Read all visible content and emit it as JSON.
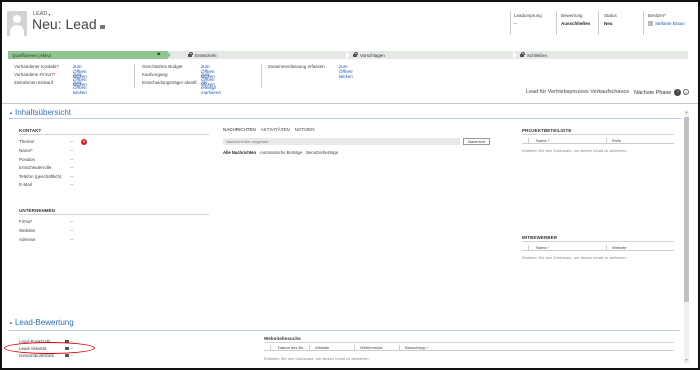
{
  "header": {
    "entity_type": "LEAD",
    "title": "Neu: Lead",
    "fields": [
      {
        "label": "Leadursprung",
        "value": "--"
      },
      {
        "label": "Bewertung",
        "value": "Ausschließen"
      },
      {
        "label": "Status",
        "value": "Neu"
      },
      {
        "label": "Besitzer",
        "value": "Stefanie Braun"
      }
    ]
  },
  "process": {
    "stages": [
      {
        "label": "Qualifizieren (Aktiv)",
        "active": true
      },
      {
        "label": "Entwickeln",
        "locked": true
      },
      {
        "label": "Vorschlagen",
        "locked": true
      },
      {
        "label": "Schließen",
        "locked": true
      }
    ],
    "fields": [
      {
        "label": "Vorhandener Kontakt?",
        "value": "zum Öffnen klicken"
      },
      {
        "label": "Vorhandene Firma?",
        "value": "zum Öffnen klicken"
      },
      {
        "label": "Zeitrahmen Einkauf",
        "value": "zum Öffnen klicken"
      },
      {
        "label": "Geschätztes Budget",
        "value": "zum Öffnen klicken"
      },
      {
        "label": "Kaufvorgang",
        "value": "zum Öffnen klicken"
      },
      {
        "label": "Entscheidungsträger identif.",
        "value": "Als erledigt markieren"
      },
      {
        "label": "Zusammenfassung erfassen",
        "value": "zum Öffnen klicken"
      }
    ],
    "process_name": "Lead für Vertriebsprozess Verkaufschance",
    "next_phase": "Nächste Phase"
  },
  "summary": {
    "section_title": "Inhaltsübersicht",
    "contact": {
      "title": "KONTAKT",
      "fields": [
        {
          "label": "Thema",
          "value": "--",
          "required": true,
          "error": true
        },
        {
          "label": "Name",
          "value": "--",
          "required": true
        },
        {
          "label": "Position",
          "value": "--"
        },
        {
          "label": "Entscheiderrolle",
          "value": "--"
        },
        {
          "label": "Telefon (geschäftlich)",
          "value": "--"
        },
        {
          "label": "E-Mail",
          "value": "--"
        }
      ]
    },
    "company": {
      "title": "UNTERNEHMEN",
      "fields": [
        {
          "label": "Firma",
          "value": "--",
          "required": true
        },
        {
          "label": "Website",
          "value": "--"
        },
        {
          "label": "Adresse",
          "value": "--"
        }
      ]
    },
    "activity": {
      "tabs": [
        "NACHRICHTEN",
        "AKTIVITÄTEN",
        "NOTIZEN"
      ],
      "note_placeholder": "Nachricht hier eingeben",
      "post_button": "Nachricht",
      "filters": [
        "Alle Nachrichten",
        "Automatische Beiträge",
        "Benutzerbeiträge"
      ]
    },
    "stakeholders": {
      "title": "PROJEKTBETEILIGTE",
      "columns": [
        "Name ↑",
        "Rolle"
      ],
      "empty": "Erstellen Sie den Datensatz, um diesen Inhalt zu aktivieren."
    },
    "competitors": {
      "title": "MITBEWERBER",
      "columns": [
        "Name ↑",
        "Website"
      ],
      "empty": "Erstellen Sie den Datensatz, um diesen Inhalt zu aktivieren."
    }
  },
  "scoring": {
    "section_title": "Lead-Bewertung",
    "fields": [
      {
        "label": "Lead-Punktzahl",
        "value": "--"
      },
      {
        "label": "Lead-Aktivität",
        "value": "--"
      },
      {
        "label": "Gesamtpunktzahl",
        "value": "--"
      }
    ],
    "web_visits": {
      "title": "Websitebesuche",
      "columns": [
        "Datum des Be...",
        "Website",
        "Webformular",
        "Besuchstyp ↑"
      ],
      "empty": "Erstellen Sie den Datensatz, um diesen Inhalt zu aktivieren."
    }
  },
  "colors": {
    "accent": "#2f6fb5",
    "stage_active": "#8fc58f",
    "stage_inactive": "#e4e9e4",
    "error": "#d21f1f",
    "annotation": "#e00000"
  }
}
